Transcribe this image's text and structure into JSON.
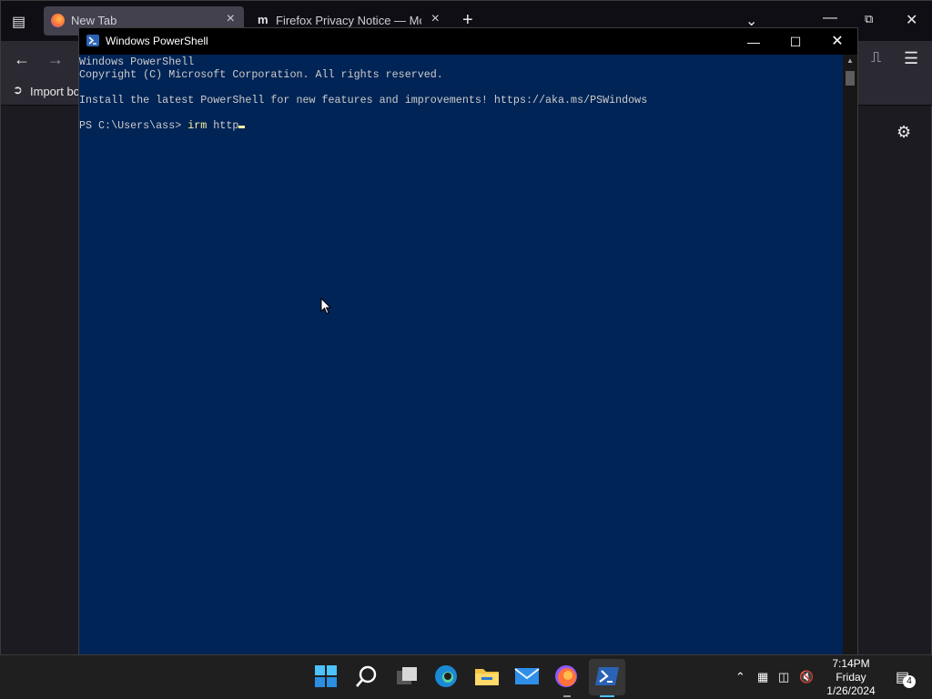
{
  "browser": {
    "tabs": [
      {
        "label": "New Tab"
      },
      {
        "label": "Firefox Privacy Notice — Mozilla"
      }
    ],
    "bookmarks": {
      "import_label": "Import bo"
    }
  },
  "powershell": {
    "title": "Windows PowerShell",
    "lines": [
      "Windows PowerShell",
      "Copyright (C) Microsoft Corporation. All rights reserved.",
      "",
      "Install the latest PowerShell for new features and improvements! https://aka.ms/PSWindows",
      ""
    ],
    "prompt": "PS C:\\Users\\ass> ",
    "command": "irm",
    "argument": " http"
  },
  "taskbar": {
    "apps": [
      "start-icon",
      "search-icon",
      "task-view-icon",
      "edge-icon",
      "file-explorer-icon",
      "mail-icon",
      "firefox-icon",
      "powershell-icon"
    ],
    "clock": {
      "time": "7:14PM",
      "day": "Friday",
      "date": "1/26/2024"
    },
    "notification_count": "4"
  },
  "colors": {
    "ps_background": "#012456",
    "ps_text": "#cccccc",
    "ps_command": "#f9f1a5",
    "taskbar": "#1f1f1f"
  }
}
